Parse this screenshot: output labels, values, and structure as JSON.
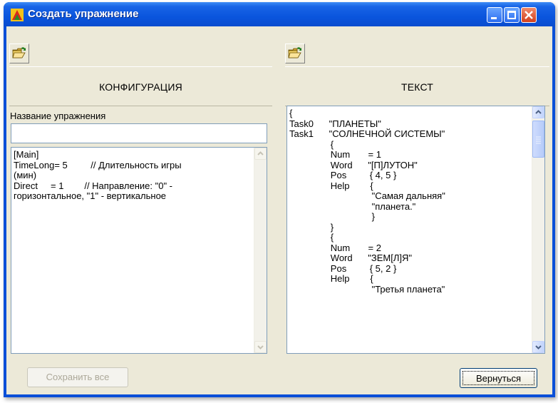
{
  "window": {
    "title": "Создать упражнение",
    "controls": [
      "minimize-icon",
      "maximize-icon",
      "close-icon"
    ]
  },
  "left_panel": {
    "open_icon": "open-folder-icon",
    "header": "КОНФИГУРАЦИЯ",
    "name_label": "Название упражнения",
    "name_value": "",
    "config_text": "[Main]\nTimeLong= 5         // Длительность игры\n(мин)\nDirect     = 1        // Направление: \"0\" -\nгоризонтальное, \"1\" - вертикальное"
  },
  "right_panel": {
    "open_icon": "open-folder-icon",
    "header": "ТЕКСТ",
    "text": "{\nTask0      \"ПЛАНЕТЫ\"\nTask1      \"СОЛНЕЧНОЙ СИСТЕМЫ\"\n                {\n                Num       = 1\n                Word      \"[П]ЛУТОН\"\n                Pos         { 4, 5 }\n                Help        {\n                                \"Самая дальняя\"\n                                \"планета.\"\n                                }\n                }\n                {\n                Num       = 2\n                Word      \"ЗЕМ[Л]Я\"\n                Pos         { 5, 2 }\n                Help        {\n                                \"Третья планета\""
  },
  "buttons": {
    "save_all": "Сохранить все",
    "back": "Вернуться"
  },
  "colors": {
    "titlebar": "#0a55dd",
    "face": "#ece9d8",
    "close": "#d2401e"
  }
}
